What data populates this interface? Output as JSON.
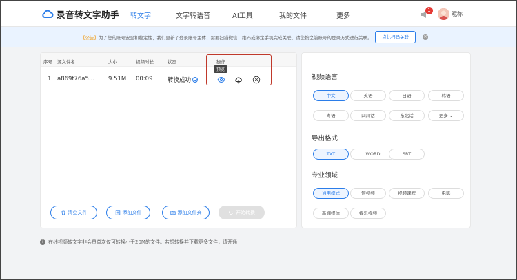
{
  "header": {
    "logo_text": "录音转文字助手",
    "nav": [
      "转文字",
      "文字转语音",
      "AI工具",
      "我的文件",
      "更多"
    ],
    "notification_count": "1",
    "nickname": "昵称"
  },
  "notice": {
    "tag": "【公告】",
    "text": "为了您的账号安全和稳定性，我们更新了登录账号主体，需要扫描微信二维码或绑定手机完成关联，请您按之前账号的登录方式进行关联。",
    "button": "点此扫码关联"
  },
  "table": {
    "headers": [
      "序号",
      "源文件名",
      "大小",
      "视频时长",
      "状态",
      "操作"
    ],
    "rows": [
      {
        "index": "1",
        "name": "a869f76a5...",
        "size": "9.51M",
        "duration": "00:09",
        "status": "转换成功"
      }
    ],
    "tooltip": "预览"
  },
  "buttons": {
    "clear": "清空文件",
    "add_file": "添加文件",
    "add_folder": "添加文件夹",
    "start": "开始转换"
  },
  "settings": {
    "language_title": "视频语言",
    "languages": [
      "中文",
      "英语",
      "日语",
      "韩语",
      "粤语",
      "四川话",
      "东北话",
      "更多 ⌄"
    ],
    "format_title": "导出格式",
    "formats": [
      "TXT",
      "WORD",
      "SRT"
    ],
    "domain_title": "专业领域",
    "domains": [
      "通用模式",
      "短视频",
      "视频课程",
      "电影",
      "新闻媒体",
      "娱乐视频"
    ]
  },
  "footer": {
    "note": "在线视频转文字非会员单次仅可转换小于20M的文件。若想转换并下载更多文件，请开通"
  },
  "colors": {
    "accent": "#2b7de9",
    "highlight": "#c0392b"
  }
}
